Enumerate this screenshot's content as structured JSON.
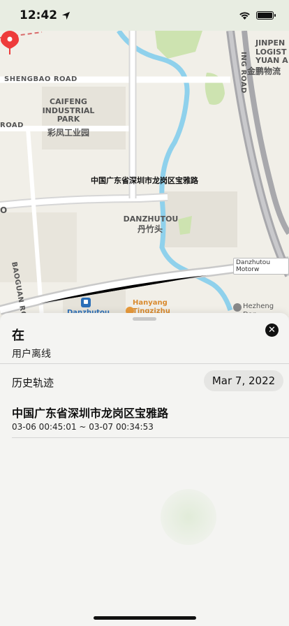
{
  "status_bar": {
    "time": "12:42"
  },
  "map": {
    "road_labels": {
      "shengbao": "SHENGBAO ROAD",
      "road_left": "ROAD",
      "baoguan": "BAOGUAN ROAD",
      "jinpeng_road": "ING ROAD"
    },
    "places": {
      "caifeng_en": "CAIFENG\nINDUSTRIAL\nPARK",
      "caifeng_zh": "彩凤工业园",
      "danzhutou_en": "DANZHUTOU",
      "danzhutou_zh": "丹竹头",
      "jinpeng_en": "JINPEN\nLOGIST\nYUAN A",
      "jinpeng_zh": "金鹏物流",
      "hanyang_en": "Hanyang\nTingzizhu",
      "hezheng": "Hezheng Dan",
      "danzhutou_station": "Danzhutou",
      "motorway": "Danzhutou Motorw",
      "left_edge": "O"
    },
    "pin_address": "中国广东省深圳市龙岗区宝雅路"
  },
  "sheet": {
    "status_title": "在",
    "status_sub": "用户离线",
    "close_icon": "close-icon",
    "history_label": "历史轨迹",
    "date": "Mar 7, 2022",
    "record": {
      "title": "中国广东省深圳市龙岗区宝雅路",
      "time_range": "03-06 00:45:01 ~ 03-07 00:34:53"
    }
  }
}
